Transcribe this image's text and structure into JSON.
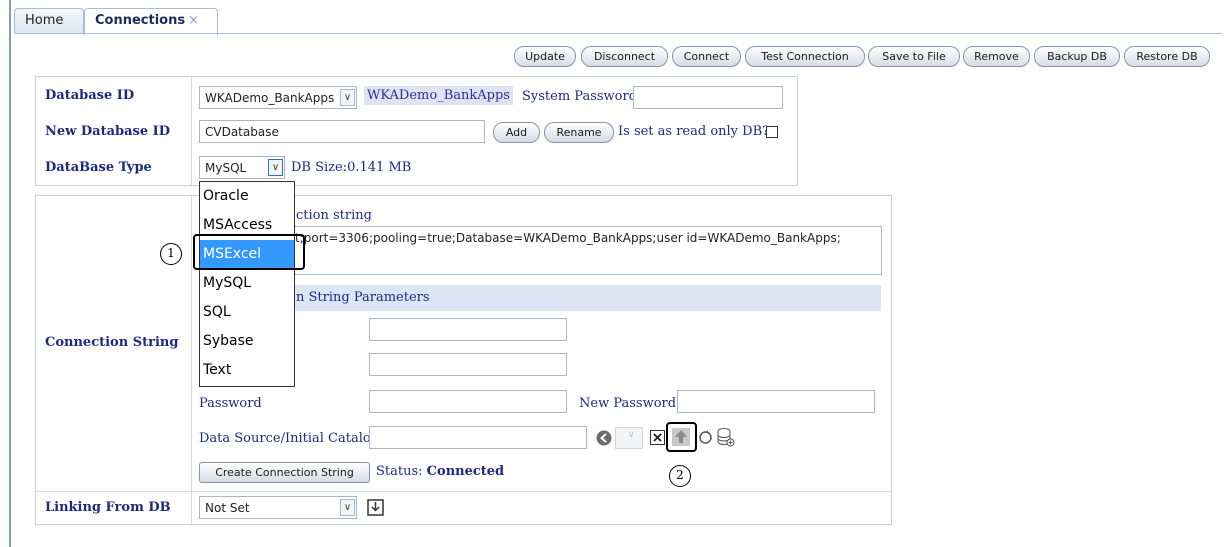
{
  "tabs": [
    {
      "label": "Home"
    },
    {
      "label": "Connections",
      "close": "×"
    }
  ],
  "toolbar": {
    "update": "Update",
    "disconnect": "Disconnect",
    "connect": "Connect",
    "test_connection": "Test Connection",
    "save_to_file": "Save to File",
    "remove": "Remove",
    "backup_db": "Backup DB",
    "restore_db": "Restore DB"
  },
  "db_panel": {
    "database_id_label": "Database ID",
    "database_id_value": "WKADemo_BankApps",
    "database_id_display": "WKADemo_BankApps",
    "system_password_label": "System Password",
    "system_password_value": "",
    "new_database_id_label": "New Database ID",
    "new_database_id_value": "CVDatabase",
    "add_label": "Add",
    "rename_label": "Rename",
    "read_only_label": "Is set as read only DB?",
    "database_type_label": "DataBase Type",
    "database_type_value": "MySQL",
    "db_size_label": "DB Size:0.141 MB"
  },
  "db_type_options": [
    "Oracle",
    "MSAccess",
    "MSExcel",
    "MySQL",
    "SQL",
    "Sybase",
    "Text"
  ],
  "db_type_selected": "MSExcel",
  "conn_panel": {
    "connection_string_label": "Connection String",
    "conn_string_header_partial": "ction string",
    "conn_string_value": "t;port=3306;pooling=true;Database=WKADemo_BankApps;user id=WKADemo_BankApps;",
    "params_header_partial": "n String Parameters",
    "password_label": "Password",
    "new_password_label": "New Password:",
    "data_source_label": "Data Source/Initial Catalog",
    "create_button": "Create Connection String",
    "status_label": "Status:",
    "status_value": "Connected",
    "linking_label": "Linking From DB",
    "linking_value": "Not Set"
  },
  "callouts": [
    "1",
    "2"
  ],
  "icons": {
    "back": "back-arrow-icon",
    "clear": "clear-x-icon",
    "upload": "upload-icon",
    "refresh": "refresh-icon",
    "database_add": "database-add-icon",
    "import": "import-icon",
    "dropdown": "chevron-down-icon"
  }
}
